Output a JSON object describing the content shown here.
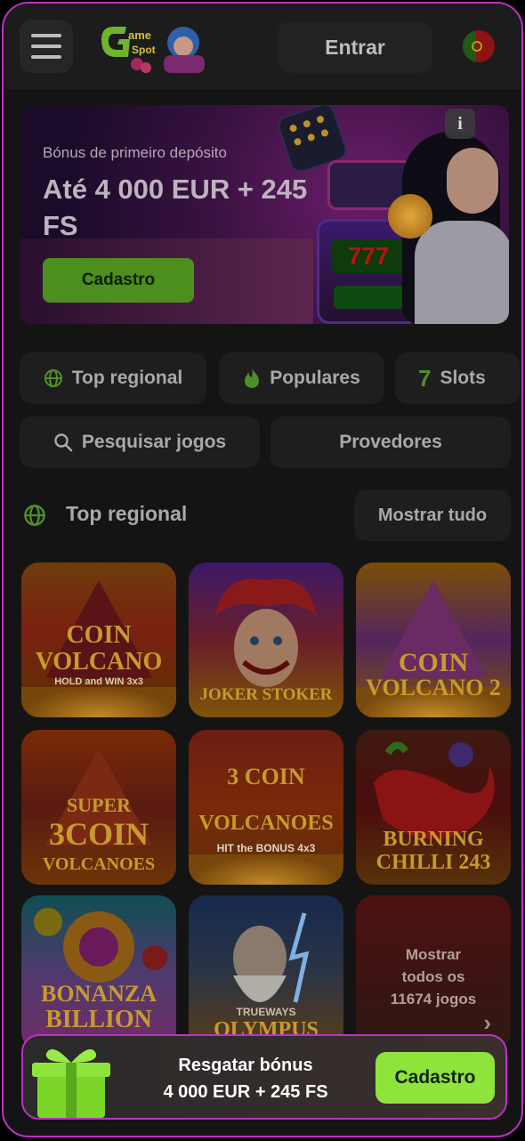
{
  "header": {
    "menu_icon": "hamburger-menu-icon",
    "logo_text": "GameSpot",
    "login_label": "Entrar",
    "language_flag": "portugal-flag-icon"
  },
  "banner": {
    "subtitle": "Bónus de primeiro depósito",
    "title": "Até 4 000 EUR + 245 FS",
    "cta_label": "Cadastro",
    "info_icon_label": "i"
  },
  "filters": {
    "top_regional": "Top regional",
    "popular": "Populares",
    "slots_digit": "7",
    "slots": "Slots",
    "search": "Pesquisar jogos",
    "providers": "Provedores"
  },
  "section": {
    "title": "Top regional",
    "show_all": "Mostrar tudo"
  },
  "games": [
    {
      "title_line1": "COIN",
      "title_line2": "VOLCANO",
      "badge": "HOLD and WIN 3x3"
    },
    {
      "title_line1": "JOKER STOKER"
    },
    {
      "title_line1": "COIN",
      "title_line2": "VOLCANO 2"
    },
    {
      "title_line1": "SUPER",
      "title_line2": "3COIN",
      "title_line3": "VOLCANOES"
    },
    {
      "title_line1": "3 COIN",
      "title_line2": "VOLCANOES",
      "badge": "HIT the BONUS 4x3"
    },
    {
      "title_line1": "BURNING",
      "title_line2": "CHILLI 243"
    },
    {
      "title_line1": "BONANZA",
      "title_line2": "BILLION"
    },
    {
      "title_line1": "TRUEWAYS",
      "title_line2": "OLYMPUS"
    }
  ],
  "show_more": {
    "line1": "Mostrar",
    "line2": "todos os",
    "line3": "11674 jogos",
    "arrow": "›"
  },
  "bottom_bar": {
    "line1": "Resgatar bónus",
    "line2": "4 000 EUR + 245 FS",
    "cta_label": "Cadastro"
  },
  "colors": {
    "accent_green": "#8ee43a",
    "border_magenta": "#c02fc8",
    "background": "#141414"
  }
}
